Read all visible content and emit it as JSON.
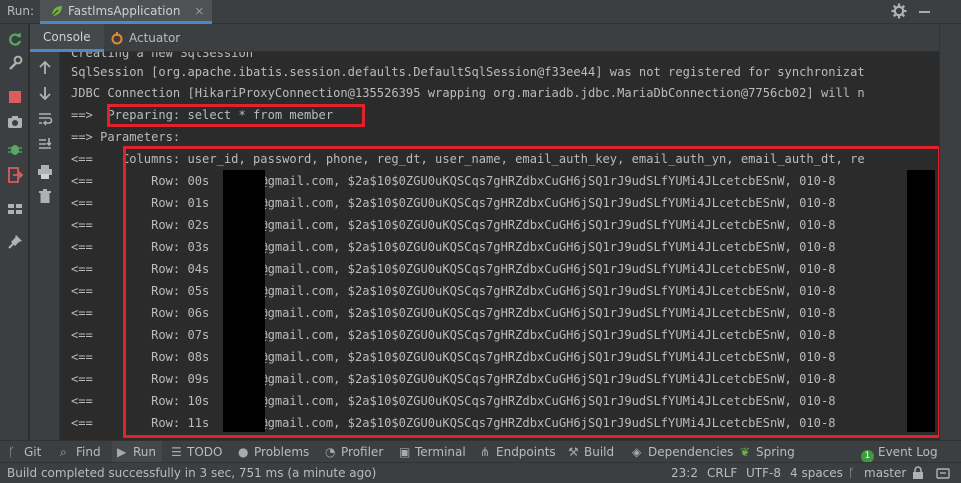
{
  "header": {
    "run_label": "Run:",
    "tab_title": "FastlmsApplication",
    "close_glyph": "×"
  },
  "subtabs": {
    "console": "Console",
    "actuator": "Actuator"
  },
  "console": {
    "lines": [
      "Creating a new SqlSession",
      "SqlSession [org.apache.ibatis.session.defaults.DefaultSqlSession@f33ee44] was not registered for synchronizat",
      "JDBC Connection [HikariProxyConnection@135526395 wrapping org.mariadb.jdbc.MariaDbConnection@7756cb02] will n",
      "==>  Preparing: select * from member",
      "==> Parameters: ",
      "<==    Columns: user_id, password, phone, reg_dt, user_name, email_auth_key, email_auth_yn, email_auth_dt, re",
      "<==        Row: 00s     le@gmail.com, $2a$10$0ZGU0uKQSCqs7gHRZdbxCuGH6jSQ1rJ9udSLfYUMi4JLcetcbESnW, 010-8",
      "<==        Row: 01s     le@gmail.com, $2a$10$0ZGU0uKQSCqs7gHRZdbxCuGH6jSQ1rJ9udSLfYUMi4JLcetcbESnW, 010-8",
      "<==        Row: 02s     le@gmail.com, $2a$10$0ZGU0uKQSCqs7gHRZdbxCuGH6jSQ1rJ9udSLfYUMi4JLcetcbESnW, 010-8",
      "<==        Row: 03s     le@gmail.com, $2a$10$0ZGU0uKQSCqs7gHRZdbxCuGH6jSQ1rJ9udSLfYUMi4JLcetcbESnW, 010-8",
      "<==        Row: 04s     le@gmail.com, $2a$10$0ZGU0uKQSCqs7gHRZdbxCuGH6jSQ1rJ9udSLfYUMi4JLcetcbESnW, 010-8",
      "<==        Row: 05s     le@gmail.com, $2a$10$0ZGU0uKQSCqs7gHRZdbxCuGH6jSQ1rJ9udSLfYUMi4JLcetcbESnW, 010-8",
      "<==        Row: 06s     le@gmail.com, $2a$10$0ZGU0uKQSCqs7gHRZdbxCuGH6jSQ1rJ9udSLfYUMi4JLcetcbESnW, 010-8",
      "<==        Row: 07s     le@gmail.com, $2a$10$0ZGU0uKQSCqs7gHRZdbxCuGH6jSQ1rJ9udSLfYUMi4JLcetcbESnW, 010-8",
      "<==        Row: 08s     le@gmail.com, $2a$10$0ZGU0uKQSCqs7gHRZdbxCuGH6jSQ1rJ9udSLfYUMi4JLcetcbESnW, 010-8",
      "<==        Row: 09s     le@gmail.com, $2a$10$0ZGU0uKQSCqs7gHRZdbxCuGH6jSQ1rJ9udSLfYUMi4JLcetcbESnW, 010-8",
      "<==        Row: 10s     le@gmail.com, $2a$10$0ZGU0uKQSCqs7gHRZdbxCuGH6jSQ1rJ9udSLfYUMi4JLcetcbESnW, 010-8",
      "<==        Row: 11s     le@gmail.com, $2a$10$0ZGU0uKQSCqs7gHRZdbxCuGH6jSQ1rJ9udSLfYUMi4JLcetcbESnW, 010-8"
    ]
  },
  "toolwindows": {
    "git": "Git",
    "find": "Find",
    "run": "Run",
    "todo": "TODO",
    "problems": "Problems",
    "profiler": "Profiler",
    "terminal": "Terminal",
    "endpoints": "Endpoints",
    "build": "Build",
    "dependencies": "Dependencies",
    "spring": "Spring",
    "event_log": "Event Log",
    "event_count": "1"
  },
  "status": {
    "message": "Build completed successfully in 3 sec, 751 ms (a minute ago)",
    "position": "23:2",
    "line_sep": "CRLF",
    "encoding": "UTF-8",
    "indent": "4 spaces",
    "branch": "master"
  },
  "colors": {
    "highlight_box": "#e0222a",
    "accent": "#4a88c7"
  }
}
